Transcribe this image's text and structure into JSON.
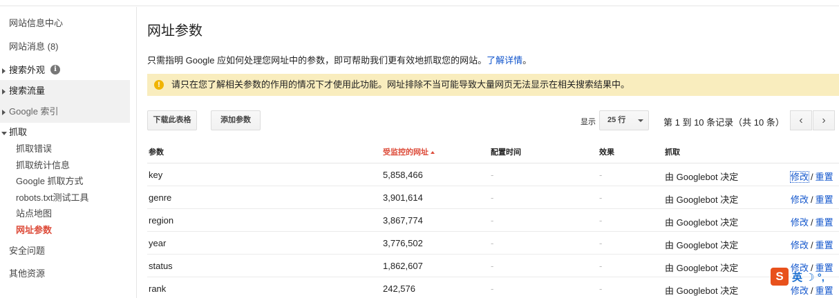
{
  "sidebar": {
    "items": [
      {
        "label": "网站信息中心"
      },
      {
        "label": "网站消息 (8)"
      },
      {
        "label": "搜索外观"
      },
      {
        "label": "搜索流量"
      },
      {
        "label": "Google 索引"
      },
      {
        "label": "抓取"
      },
      {
        "label": "安全问题"
      },
      {
        "label": "其他资源"
      }
    ],
    "crawl_subitems": [
      {
        "label": "抓取错误"
      },
      {
        "label": "抓取统计信息"
      },
      {
        "label": "Google 抓取方式"
      },
      {
        "label": "robots.txt测试工具"
      },
      {
        "label": "站点地图"
      },
      {
        "label": "网址参数",
        "active": true
      }
    ],
    "info_icon": "info-icon"
  },
  "main": {
    "title": "网址参数",
    "intro_text": "只需指明 Google 应如何处理您网址中的参数，即可帮助我们更有效地抓取您的网站。",
    "intro_link": "了解详情",
    "intro_end": "。",
    "warning": "请只在您了解相关参数的作用的情况下才使用此功能。网址排除不当可能导致大量网页无法显示在相关搜索结果中。",
    "warning_icon": "!",
    "toolbar": {
      "download_label": "下载此表格",
      "add_label": "添加参数",
      "show_label": "显示",
      "rows_value": "25 行",
      "records_text": "第 1 到 10 条记录（共 10 条）",
      "prev_icon": "‹",
      "next_icon": "›"
    }
  },
  "table": {
    "headers": [
      "参数",
      "受监控的网址",
      "配置时间",
      "效果",
      "抓取"
    ],
    "sorted_column": 1,
    "action_edit": "修改",
    "action_sep": "/",
    "action_reset": "重置",
    "rows": [
      {
        "param": "key",
        "urls": "5,858,466",
        "time": "-",
        "effect": "-",
        "crawl": "由 Googlebot 决定"
      },
      {
        "param": "genre",
        "urls": "3,901,614",
        "time": "-",
        "effect": "-",
        "crawl": "由 Googlebot 决定"
      },
      {
        "param": "region",
        "urls": "3,867,774",
        "time": "-",
        "effect": "-",
        "crawl": "由 Googlebot 决定"
      },
      {
        "param": "year",
        "urls": "3,776,502",
        "time": "-",
        "effect": "-",
        "crawl": "由 Googlebot 决定"
      },
      {
        "param": "status",
        "urls": "1,862,607",
        "time": "-",
        "effect": "-",
        "crawl": "由 Googlebot 决定"
      },
      {
        "param": "rank",
        "urls": "242,576",
        "time": "-",
        "effect": "-",
        "crawl": "由 Googlebot 决定"
      }
    ]
  },
  "ime": {
    "logo": "S",
    "text": "英 ☽ °, "
  },
  "colors": {
    "accent_red": "#dd4b39",
    "link_blue": "#1155cc",
    "warning_bg": "#f9edbe"
  }
}
